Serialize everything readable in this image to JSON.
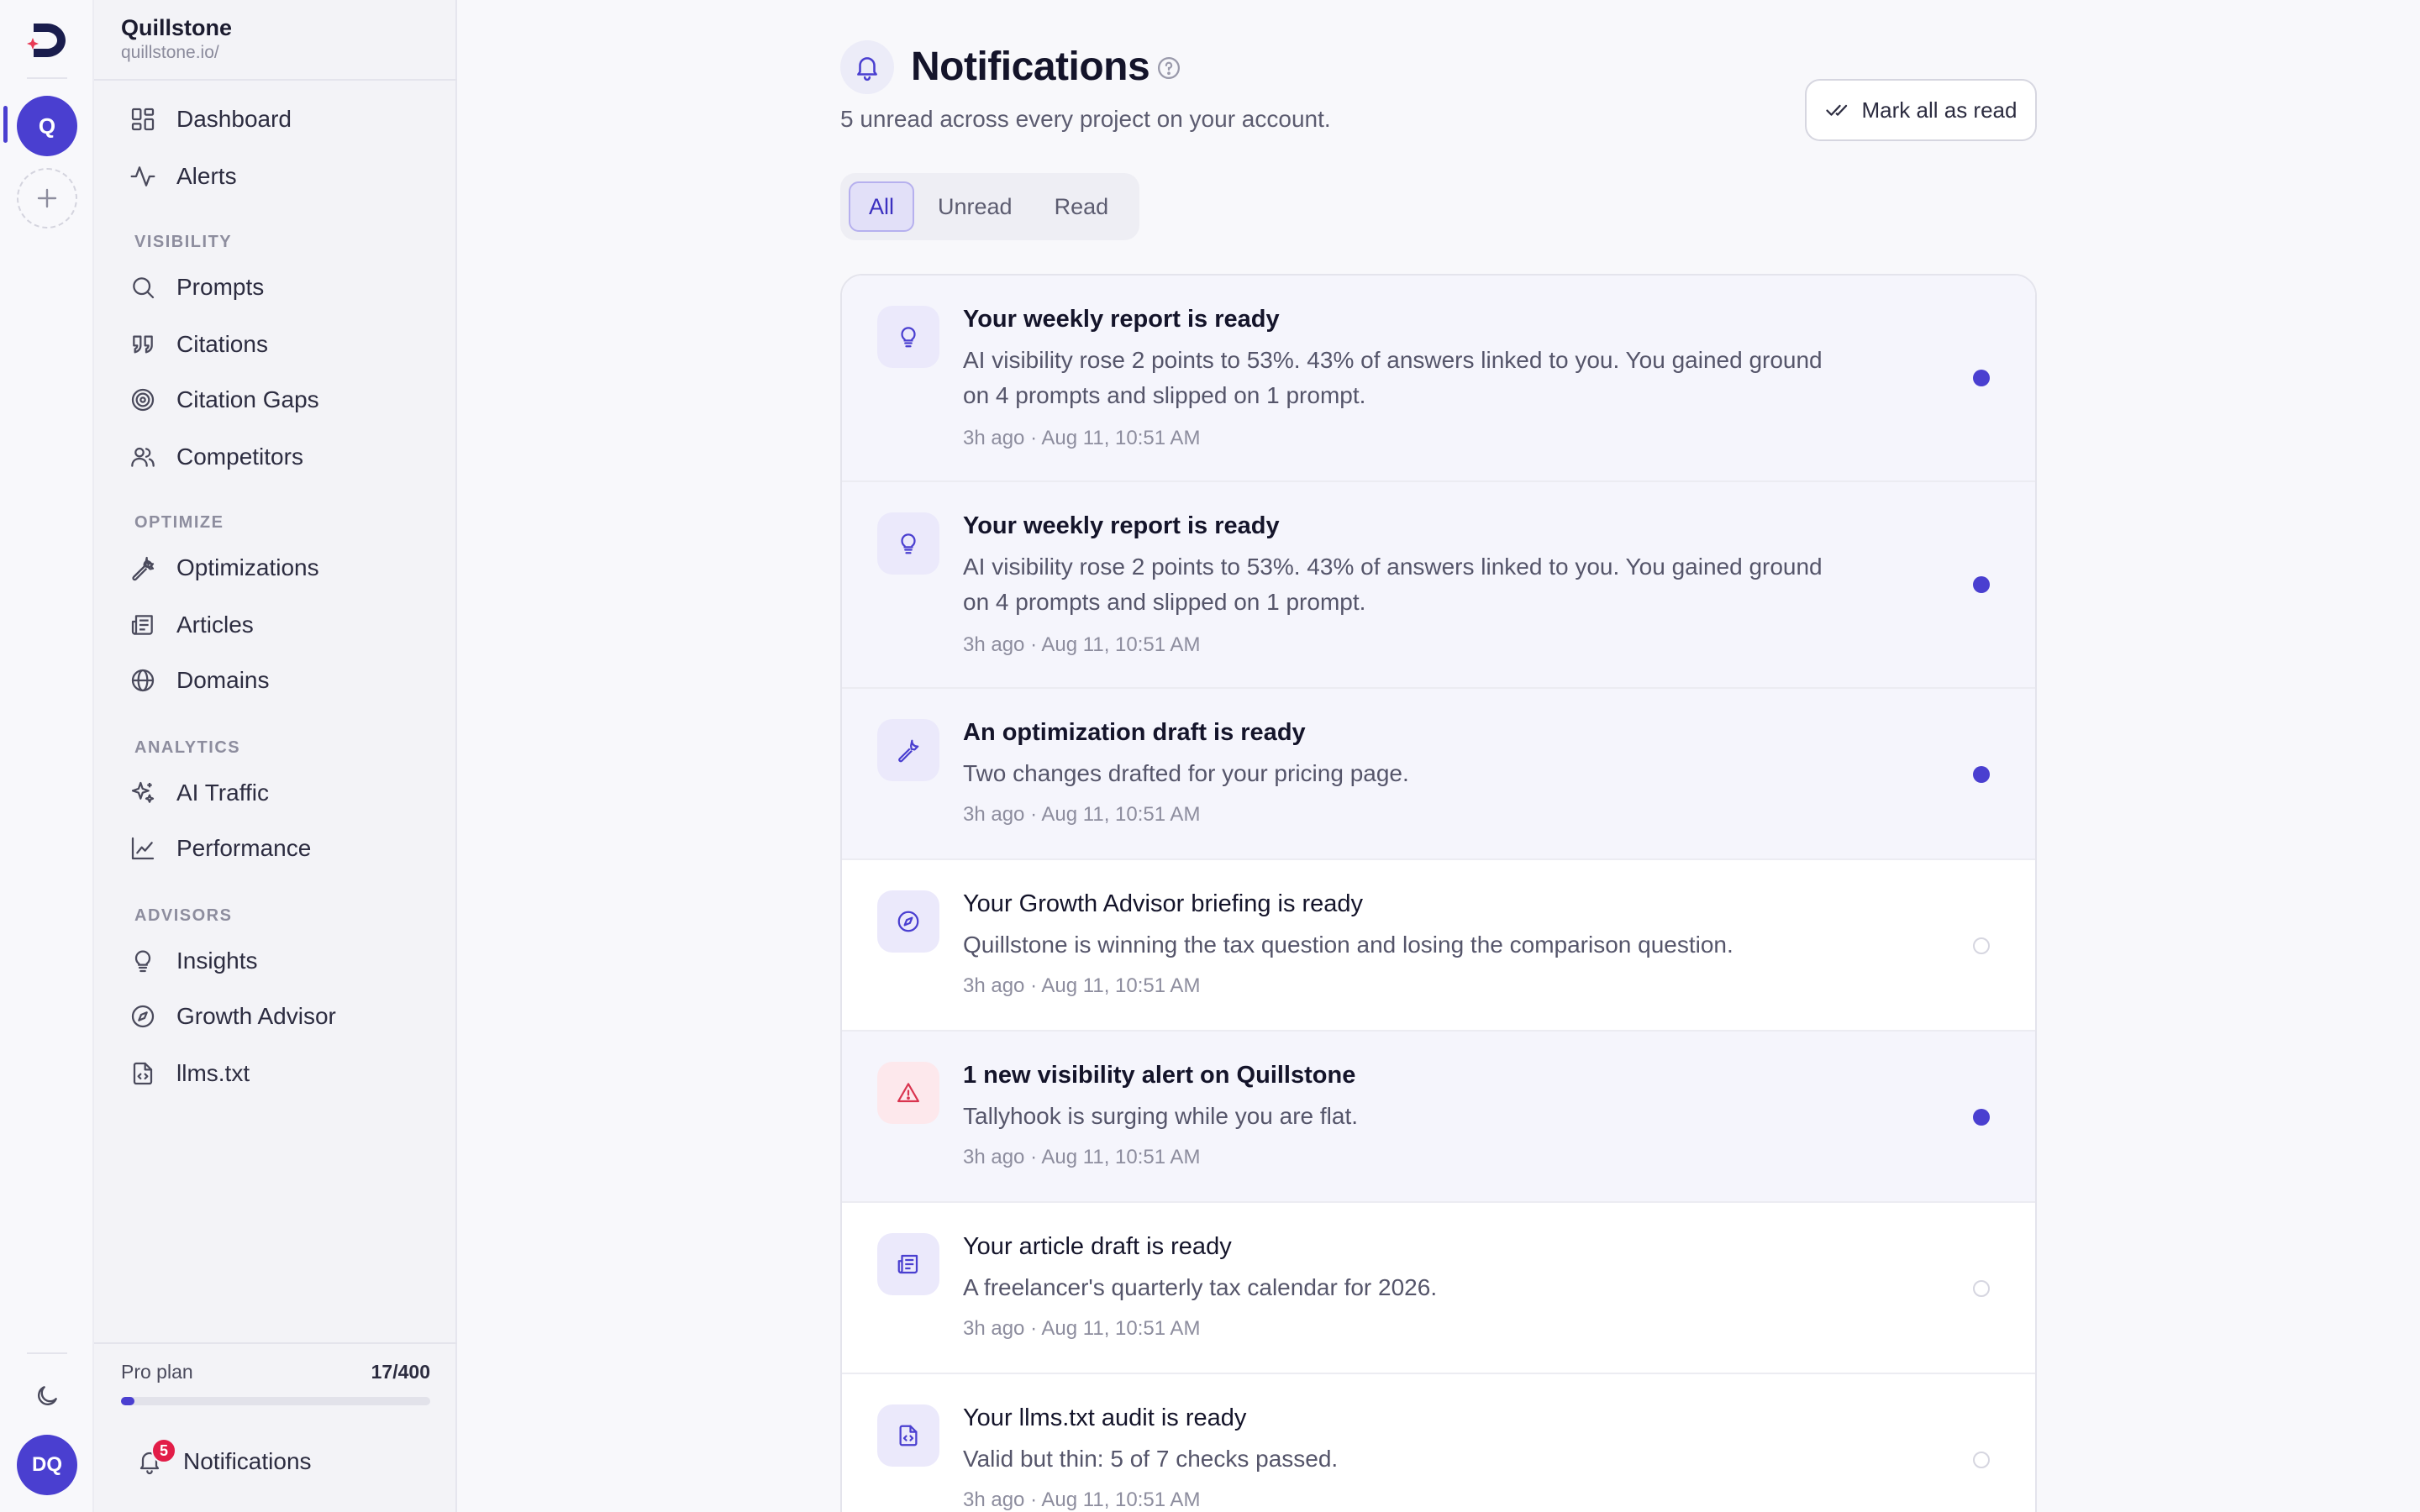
{
  "rail": {
    "workspace_initial": "Q",
    "user_initials": "DQ"
  },
  "sidebar": {
    "project_name": "Quillstone",
    "project_url": "quillstone.io/",
    "top_items": [
      {
        "label": "Dashboard",
        "icon": "dashboard-icon"
      },
      {
        "label": "Alerts",
        "icon": "activity-icon"
      }
    ],
    "sections": [
      {
        "label": "VISIBILITY",
        "items": [
          {
            "label": "Prompts",
            "icon": "search-icon"
          },
          {
            "label": "Citations",
            "icon": "quote-icon"
          },
          {
            "label": "Citation Gaps",
            "icon": "target-icon"
          },
          {
            "label": "Competitors",
            "icon": "users-icon"
          }
        ]
      },
      {
        "label": "OPTIMIZE",
        "items": [
          {
            "label": "Optimizations",
            "icon": "wrench-icon"
          },
          {
            "label": "Articles",
            "icon": "newspaper-icon"
          },
          {
            "label": "Domains",
            "icon": "globe-icon"
          }
        ]
      },
      {
        "label": "ANALYTICS",
        "items": [
          {
            "label": "AI Traffic",
            "icon": "sparkles-icon"
          },
          {
            "label": "Performance",
            "icon": "line-chart-icon"
          }
        ]
      },
      {
        "label": "ADVISORS",
        "items": [
          {
            "label": "Insights",
            "icon": "lightbulb-icon"
          },
          {
            "label": "Growth Advisor",
            "icon": "compass-icon"
          },
          {
            "label": "llms.txt",
            "icon": "file-code-icon"
          }
        ]
      }
    ],
    "plan": {
      "label": "Pro plan",
      "count": "17/400",
      "used_fraction": 0.0425
    },
    "notifications": {
      "label": "Notifications",
      "badge": "5"
    }
  },
  "main": {
    "title": "Notifications",
    "subtitle": "5 unread across every project on your account.",
    "mark_all_label": "Mark all as read",
    "tabs": [
      {
        "label": "All",
        "active": true
      },
      {
        "label": "Unread",
        "active": false
      },
      {
        "label": "Read",
        "active": false
      }
    ],
    "notifications": [
      {
        "title": "Your weekly report is ready",
        "body": "AI visibility rose 2 points to 53%. 43% of answers linked to you. You gained ground on 4 prompts and slipped on 1 prompt.",
        "time": "3h ago · Aug 11, 10:51 AM",
        "unread": true,
        "icon": "lightbulb-icon"
      },
      {
        "title": "Your weekly report is ready",
        "body": "AI visibility rose 2 points to 53%. 43% of answers linked to you. You gained ground on 4 prompts and slipped on 1 prompt.",
        "time": "3h ago · Aug 11, 10:51 AM",
        "unread": true,
        "icon": "lightbulb-icon"
      },
      {
        "title": "An optimization draft is ready",
        "body": "Two changes drafted for your pricing page.",
        "time": "3h ago · Aug 11, 10:51 AM",
        "unread": true,
        "icon": "wrench-icon"
      },
      {
        "title": "Your Growth Advisor briefing is ready",
        "body": "Quillstone is winning the tax question and losing the comparison question.",
        "time": "3h ago · Aug 11, 10:51 AM",
        "unread": false,
        "icon": "compass-icon"
      },
      {
        "title": "1 new visibility alert on Quillstone",
        "body": "Tallyhook is surging while you are flat.",
        "time": "3h ago · Aug 11, 10:51 AM",
        "unread": true,
        "icon": "alert-triangle-icon"
      },
      {
        "title": "Your article draft is ready",
        "body": "A freelancer's quarterly tax calendar for 2026.",
        "time": "3h ago · Aug 11, 10:51 AM",
        "unread": false,
        "icon": "newspaper-icon"
      },
      {
        "title": "Your llms.txt audit is ready",
        "body": "Valid but thin: 5 of 7 checks passed.",
        "time": "3h ago · Aug 11, 10:51 AM",
        "unread": false,
        "icon": "file-code-icon"
      }
    ]
  },
  "colors": {
    "accent": "#4a3fd0",
    "badge": "#e21d48",
    "alert_icon": "#d9344f"
  }
}
